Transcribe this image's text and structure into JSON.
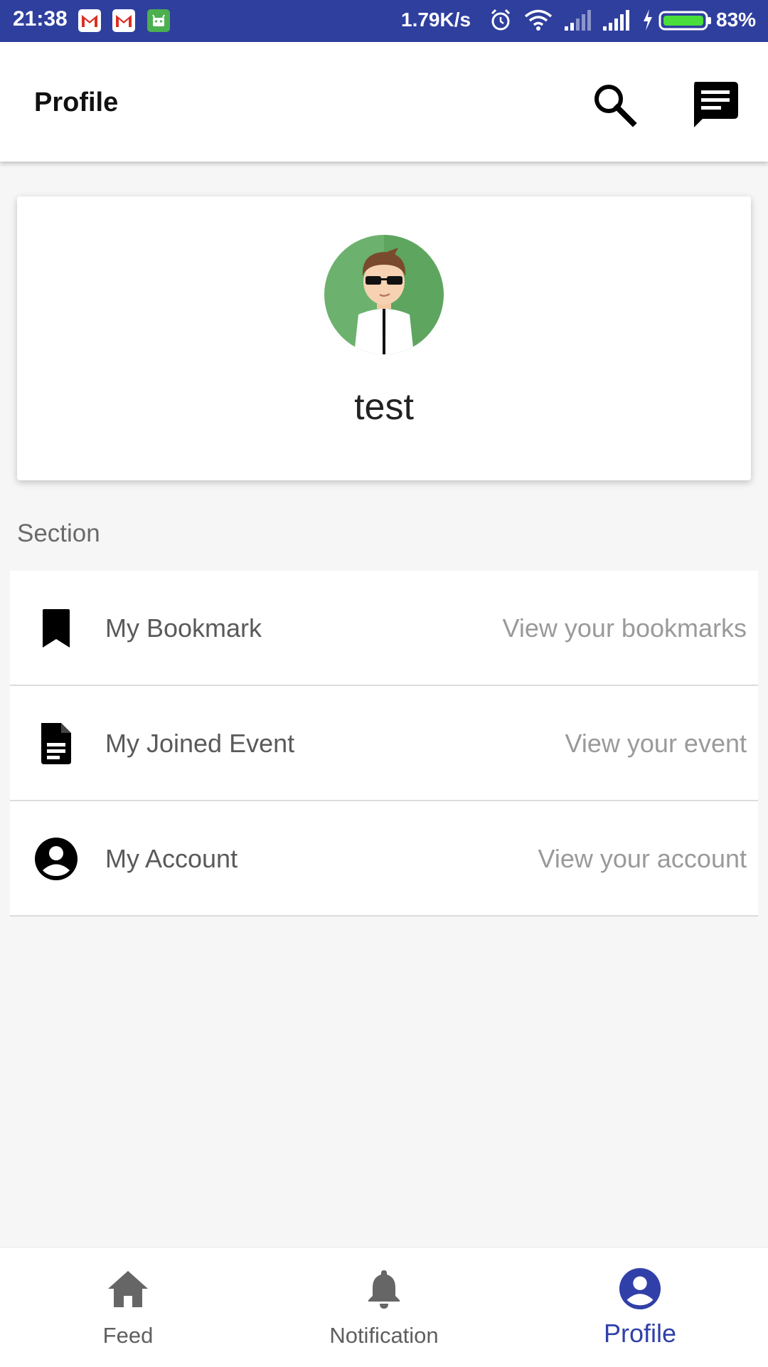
{
  "status_bar": {
    "time": "21:38",
    "network_speed": "1.79K/s",
    "battery_percent": "83%",
    "background_color": "#2f3f9e",
    "notification_icons": [
      "gmail-icon",
      "gmail-icon",
      "android-icon"
    ]
  },
  "app_bar": {
    "title": "Profile",
    "actions": [
      "search-icon",
      "chat-icon"
    ]
  },
  "profile": {
    "name": "test",
    "avatar": "cartoon-avatar-sunglasses"
  },
  "section": {
    "label": "Section",
    "items": [
      {
        "icon": "bookmark-icon",
        "label": "My Bookmark",
        "subtitle": "View your bookmarks"
      },
      {
        "icon": "document-icon",
        "label": "My Joined Event",
        "subtitle": "View your event"
      },
      {
        "icon": "account-circle-icon",
        "label": "My Account",
        "subtitle": "View your account"
      }
    ]
  },
  "bottom_nav": {
    "active_color": "#3140a8",
    "items": [
      {
        "icon": "home-icon",
        "label": "Feed",
        "active": false
      },
      {
        "icon": "bell-icon",
        "label": "Notification",
        "active": false
      },
      {
        "icon": "account-circle-icon",
        "label": "Profile",
        "active": true
      }
    ]
  }
}
